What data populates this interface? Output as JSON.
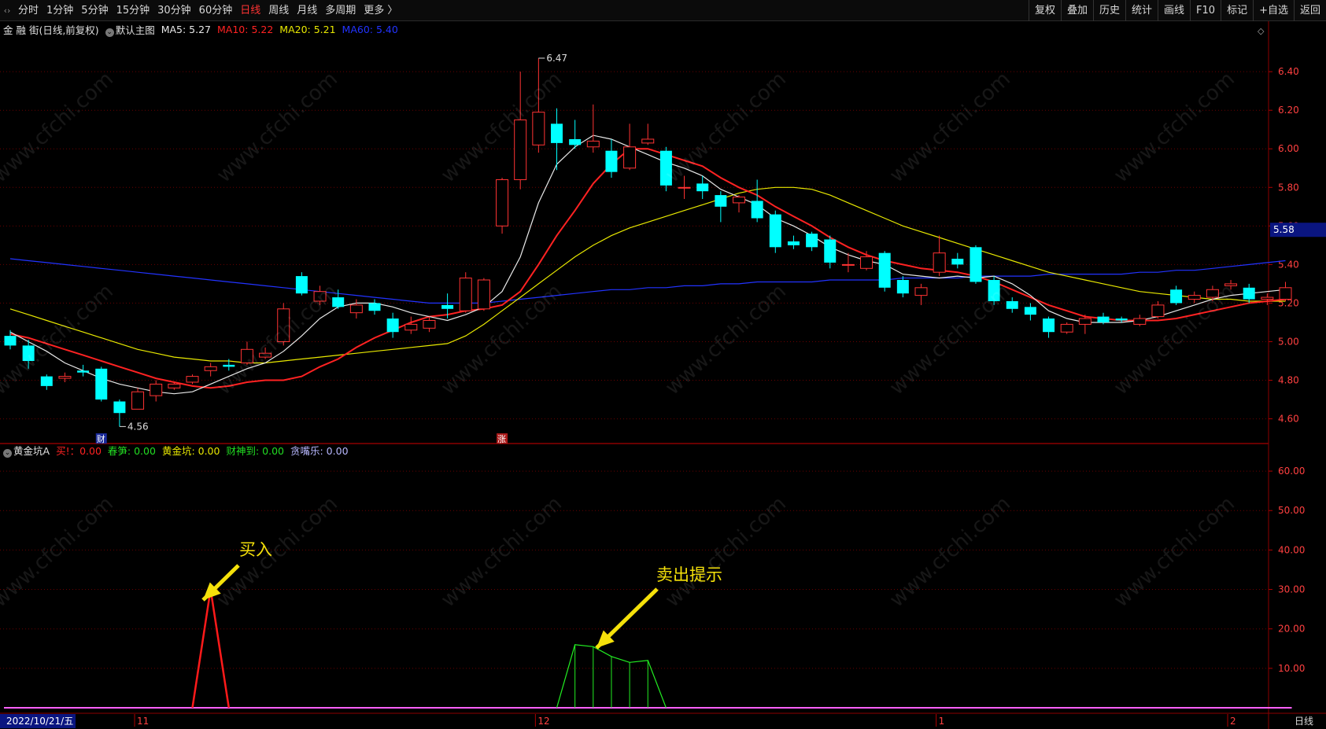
{
  "toolbar": {
    "left_items": [
      "分时",
      "1分钟",
      "5分钟",
      "15分钟",
      "30分钟",
      "60分钟",
      "日线",
      "周线",
      "月线",
      "多周期",
      "更多 〉"
    ],
    "active_item": "日线",
    "right_items": [
      "复权",
      "叠加",
      "历史",
      "统计",
      "画线",
      "F10",
      "标记",
      "+自选",
      "返回"
    ]
  },
  "main_legend": {
    "stock": "金 融 街(日线,前复权)",
    "template": "默认主图",
    "ma5": {
      "label": "MA5: 5.27",
      "color": "#e8e8e8"
    },
    "ma10": {
      "label": "MA10: 5.22",
      "color": "#ff2222"
    },
    "ma20": {
      "label": "MA20: 5.21",
      "color": "#e8e800"
    },
    "ma60": {
      "label": "MA60: 5.40",
      "color": "#2233ff"
    }
  },
  "sub_legend": {
    "name": "黄金坑A",
    "items": [
      {
        "label": "买!：0.00",
        "color": "#ff2222"
      },
      {
        "label": "春笋: 0.00",
        "color": "#22dd22"
      },
      {
        "label": "黄金坑: 0.00",
        "color": "#e8e800"
      },
      {
        "label": "财神到: 0.00",
        "color": "#22dd22"
      },
      {
        "label": "贪嘴乐: 0.00",
        "color": "#b8b8ff"
      }
    ]
  },
  "annotations": {
    "buy": "买入",
    "sell": "卖出提示"
  },
  "watermark": "www.cfchi.com",
  "colors": {
    "up": "#ff3333",
    "down": "#00ffff",
    "grid": "#8b0000"
  },
  "chart_data": {
    "type": "candlestick",
    "price_axis": {
      "ticks": [
        6.4,
        6.2,
        6.0,
        5.8,
        5.6,
        5.4,
        5.2,
        5.0,
        4.8,
        4.6
      ],
      "labels": [
        "6.40",
        "6.20",
        "6.00",
        "5.80",
        "5.60",
        "5.40",
        "5.20",
        "5.00",
        "4.80",
        "4.60"
      ],
      "ylim": [
        4.48,
        6.58
      ],
      "current": 5.58,
      "current_label": "5.58"
    },
    "extremes": {
      "high": "6.47",
      "low": "4.56"
    },
    "markers": [
      {
        "i": 5,
        "text": "财"
      },
      {
        "i": 27,
        "text": "涨"
      }
    ],
    "candles": [
      [
        5.03,
        4.98,
        5.06,
        4.96
      ],
      [
        4.98,
        4.9,
        5.01,
        4.86
      ],
      [
        4.82,
        4.77,
        4.83,
        4.75
      ],
      [
        4.81,
        4.82,
        4.84,
        4.79
      ],
      [
        4.85,
        4.84,
        4.88,
        4.82
      ],
      [
        4.86,
        4.7,
        4.87,
        4.69
      ],
      [
        4.69,
        4.63,
        4.7,
        4.56
      ],
      [
        4.65,
        4.74,
        4.76,
        4.65
      ],
      [
        4.72,
        4.78,
        4.8,
        4.69
      ],
      [
        4.76,
        4.78,
        4.79,
        4.75
      ],
      [
        4.79,
        4.82,
        4.83,
        4.78
      ],
      [
        4.85,
        4.87,
        4.89,
        4.82
      ],
      [
        4.88,
        4.87,
        4.91,
        4.85
      ],
      [
        4.89,
        4.96,
        5.0,
        4.88
      ],
      [
        4.92,
        4.94,
        4.97,
        4.91
      ],
      [
        5.0,
        5.17,
        5.2,
        4.98
      ],
      [
        5.34,
        5.25,
        5.36,
        5.24
      ],
      [
        5.21,
        5.26,
        5.29,
        5.19
      ],
      [
        5.23,
        5.18,
        5.27,
        5.17
      ],
      [
        5.15,
        5.19,
        5.22,
        5.12
      ],
      [
        5.2,
        5.16,
        5.22,
        5.14
      ],
      [
        5.12,
        5.05,
        5.15,
        5.02
      ],
      [
        5.06,
        5.09,
        5.13,
        5.04
      ],
      [
        5.07,
        5.11,
        5.13,
        5.05
      ],
      [
        5.19,
        5.17,
        5.25,
        5.12
      ],
      [
        5.16,
        5.33,
        5.36,
        5.15
      ],
      [
        5.17,
        5.32,
        5.33,
        5.16
      ],
      [
        5.6,
        5.84,
        5.85,
        5.56
      ],
      [
        5.84,
        6.15,
        6.4,
        5.79
      ],
      [
        6.02,
        6.19,
        6.47,
        5.98
      ],
      [
        6.13,
        6.03,
        6.21,
        5.89
      ],
      [
        6.05,
        6.02,
        6.15,
        6.0
      ],
      [
        6.01,
        6.04,
        6.23,
        5.98
      ],
      [
        5.99,
        5.88,
        6.05,
        5.85
      ],
      [
        5.9,
        6.01,
        6.13,
        5.89
      ],
      [
        6.03,
        6.05,
        6.13,
        6.02
      ],
      [
        5.99,
        5.81,
        6.01,
        5.78
      ],
      [
        5.8,
        5.8,
        5.86,
        5.74
      ],
      [
        5.82,
        5.78,
        5.86,
        5.74
      ],
      [
        5.76,
        5.7,
        5.78,
        5.62
      ],
      [
        5.72,
        5.75,
        5.76,
        5.67
      ],
      [
        5.73,
        5.64,
        5.84,
        5.62
      ],
      [
        5.66,
        5.49,
        5.68,
        5.46
      ],
      [
        5.52,
        5.5,
        5.55,
        5.48
      ],
      [
        5.56,
        5.49,
        5.57,
        5.47
      ],
      [
        5.53,
        5.41,
        5.55,
        5.38
      ],
      [
        5.4,
        5.4,
        5.46,
        5.36
      ],
      [
        5.38,
        5.44,
        5.47,
        5.37
      ],
      [
        5.46,
        5.28,
        5.47,
        5.26
      ],
      [
        5.32,
        5.25,
        5.34,
        5.23
      ],
      [
        5.24,
        5.28,
        5.3,
        5.19
      ],
      [
        5.36,
        5.46,
        5.55,
        5.34
      ],
      [
        5.43,
        5.4,
        5.46,
        5.38
      ],
      [
        5.49,
        5.31,
        5.5,
        5.3
      ],
      [
        5.32,
        5.21,
        5.34,
        5.19
      ],
      [
        5.21,
        5.17,
        5.23,
        5.15
      ],
      [
        5.18,
        5.14,
        5.2,
        5.11
      ],
      [
        5.12,
        5.05,
        5.13,
        5.02
      ],
      [
        5.05,
        5.09,
        5.1,
        5.04
      ],
      [
        5.09,
        5.12,
        5.14,
        5.04
      ],
      [
        5.13,
        5.1,
        5.15,
        5.09
      ],
      [
        5.12,
        5.11,
        5.13,
        5.1
      ],
      [
        5.09,
        5.12,
        5.14,
        5.08
      ],
      [
        5.13,
        5.19,
        5.21,
        5.12
      ],
      [
        5.27,
        5.2,
        5.29,
        5.19
      ],
      [
        5.22,
        5.24,
        5.26,
        5.2
      ],
      [
        5.23,
        5.27,
        5.29,
        5.21
      ],
      [
        5.29,
        5.3,
        5.32,
        5.27
      ],
      [
        5.28,
        5.22,
        5.3,
        5.2
      ],
      [
        5.22,
        5.23,
        5.25,
        5.19
      ],
      [
        5.22,
        5.28,
        5.31,
        5.21
      ]
    ],
    "ma5": [
      5.05,
      5.0,
      4.95,
      4.89,
      4.85,
      4.81,
      4.78,
      4.76,
      4.74,
      4.73,
      4.74,
      4.78,
      4.82,
      4.86,
      4.89,
      4.95,
      5.03,
      5.12,
      5.18,
      5.2,
      5.2,
      5.18,
      5.15,
      5.13,
      5.11,
      5.14,
      5.18,
      5.26,
      5.44,
      5.72,
      5.92,
      6.01,
      6.07,
      6.05,
      6.01,
      5.97,
      5.93,
      5.9,
      5.86,
      5.79,
      5.75,
      5.71,
      5.64,
      5.6,
      5.55,
      5.49,
      5.45,
      5.42,
      5.4,
      5.35,
      5.34,
      5.33,
      5.34,
      5.33,
      5.34,
      5.3,
      5.24,
      5.16,
      5.12,
      5.1,
      5.1,
      5.1,
      5.11,
      5.13,
      5.16,
      5.19,
      5.22,
      5.24,
      5.25,
      5.26,
      5.27
    ],
    "ma10": [
      5.04,
      5.02,
      4.99,
      4.96,
      4.93,
      4.9,
      4.87,
      4.84,
      4.81,
      4.79,
      4.77,
      4.76,
      4.77,
      4.79,
      4.8,
      4.8,
      4.82,
      4.87,
      4.91,
      4.97,
      5.02,
      5.06,
      5.1,
      5.13,
      5.14,
      5.16,
      5.17,
      5.19,
      5.26,
      5.4,
      5.55,
      5.68,
      5.82,
      5.92,
      6.0,
      6.0,
      5.97,
      5.94,
      5.91,
      5.85,
      5.8,
      5.76,
      5.7,
      5.65,
      5.6,
      5.54,
      5.49,
      5.45,
      5.42,
      5.4,
      5.38,
      5.37,
      5.36,
      5.34,
      5.31,
      5.27,
      5.23,
      5.19,
      5.16,
      5.13,
      5.12,
      5.11,
      5.11,
      5.11,
      5.12,
      5.14,
      5.16,
      5.18,
      5.2,
      5.21,
      5.22
    ],
    "ma20": [
      5.17,
      5.14,
      5.11,
      5.08,
      5.05,
      5.02,
      4.99,
      4.96,
      4.94,
      4.92,
      4.91,
      4.9,
      4.9,
      4.89,
      4.89,
      4.9,
      4.91,
      4.92,
      4.93,
      4.94,
      4.95,
      4.96,
      4.97,
      4.98,
      4.99,
      5.03,
      5.09,
      5.16,
      5.23,
      5.3,
      5.37,
      5.44,
      5.5,
      5.55,
      5.59,
      5.62,
      5.65,
      5.68,
      5.71,
      5.74,
      5.77,
      5.79,
      5.8,
      5.8,
      5.79,
      5.76,
      5.72,
      5.68,
      5.64,
      5.6,
      5.57,
      5.54,
      5.51,
      5.48,
      5.45,
      5.42,
      5.39,
      5.36,
      5.34,
      5.32,
      5.3,
      5.28,
      5.26,
      5.25,
      5.24,
      5.23,
      5.22,
      5.22,
      5.21,
      5.21,
      5.21
    ],
    "ma60": [
      5.43,
      5.42,
      5.41,
      5.4,
      5.39,
      5.38,
      5.37,
      5.36,
      5.35,
      5.34,
      5.33,
      5.32,
      5.31,
      5.3,
      5.29,
      5.28,
      5.27,
      5.26,
      5.25,
      5.24,
      5.23,
      5.22,
      5.21,
      5.2,
      5.2,
      5.2,
      5.2,
      5.21,
      5.22,
      5.23,
      5.24,
      5.25,
      5.26,
      5.27,
      5.27,
      5.28,
      5.28,
      5.29,
      5.29,
      5.3,
      5.3,
      5.31,
      5.31,
      5.31,
      5.31,
      5.32,
      5.32,
      5.32,
      5.32,
      5.33,
      5.33,
      5.33,
      5.33,
      5.34,
      5.34,
      5.34,
      5.34,
      5.35,
      5.35,
      5.35,
      5.35,
      5.35,
      5.36,
      5.36,
      5.37,
      5.37,
      5.38,
      5.39,
      5.4,
      5.41,
      5.42
    ],
    "indicator": {
      "axis_ticks": [
        60,
        50,
        40,
        30,
        20,
        10
      ],
      "axis_labels": [
        "60.00",
        "50.00",
        "40.00",
        "30.00",
        "20.00",
        "10.00"
      ],
      "ylim": [
        0,
        64
      ],
      "buy_values": [
        [
          10,
          0
        ],
        [
          11,
          30
        ],
        [
          12,
          0
        ]
      ],
      "sell_values": [
        [
          30,
          0
        ],
        [
          31,
          16
        ],
        [
          32,
          15.5
        ],
        [
          33,
          13
        ],
        [
          34,
          11.5
        ],
        [
          35,
          12
        ],
        [
          36,
          0
        ]
      ]
    },
    "date_axis": [
      {
        "i": 0,
        "label": "2022/10/21/五"
      },
      {
        "i": 7,
        "label": "11"
      },
      {
        "i": 29,
        "label": "12"
      },
      {
        "i": 51,
        "label": "1"
      },
      {
        "i": 67,
        "label": "2"
      }
    ],
    "period_label": "日线"
  }
}
